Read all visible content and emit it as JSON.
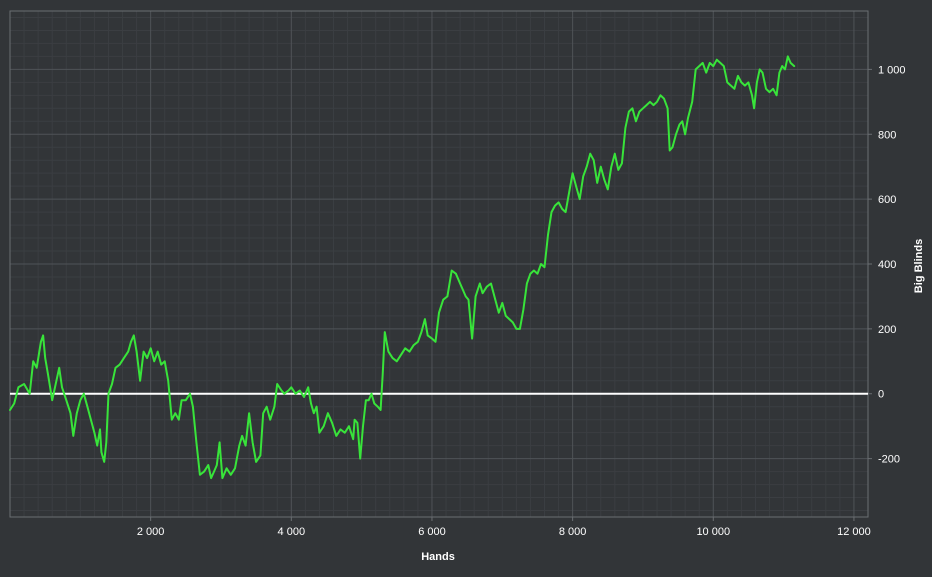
{
  "chart_data": {
    "type": "line",
    "title": "",
    "xlabel": "Hands",
    "ylabel": "Big Blinds",
    "xlim": [
      0,
      12200
    ],
    "ylim": [
      -380,
      1180
    ],
    "x_ticks": [
      2000,
      4000,
      6000,
      8000,
      10000,
      12000
    ],
    "x_tick_labels": [
      "2 000",
      "4 000",
      "6 000",
      "8 000",
      "10 000",
      "12 000"
    ],
    "y_ticks": [
      -200,
      0,
      200,
      400,
      600,
      800,
      1000
    ],
    "y_tick_labels": [
      "-200",
      "0",
      "200",
      "400",
      "600",
      "800",
      "1 000"
    ],
    "grid": true,
    "legend": "none",
    "colors": {
      "background": "#323538",
      "grid_major": "#4f5357",
      "grid_minor": "#3b3e42",
      "axis": "#6a6e72",
      "zero_line": "#ffffff",
      "series": "#38e43a",
      "text": "#ffffff"
    },
    "series": [
      {
        "name": "",
        "points": [
          [
            0,
            -50
          ],
          [
            60,
            -30
          ],
          [
            120,
            20
          ],
          [
            200,
            30
          ],
          [
            280,
            0
          ],
          [
            330,
            100
          ],
          [
            380,
            80
          ],
          [
            440,
            160
          ],
          [
            470,
            180
          ],
          [
            500,
            110
          ],
          [
            540,
            60
          ],
          [
            600,
            -20
          ],
          [
            650,
            30
          ],
          [
            700,
            80
          ],
          [
            740,
            20
          ],
          [
            800,
            -20
          ],
          [
            860,
            -60
          ],
          [
            900,
            -130
          ],
          [
            950,
            -60
          ],
          [
            1000,
            -20
          ],
          [
            1050,
            0
          ],
          [
            1100,
            -40
          ],
          [
            1150,
            -80
          ],
          [
            1200,
            -120
          ],
          [
            1240,
            -160
          ],
          [
            1280,
            -110
          ],
          [
            1300,
            -180
          ],
          [
            1340,
            -210
          ],
          [
            1370,
            -150
          ],
          [
            1400,
            0
          ],
          [
            1450,
            30
          ],
          [
            1500,
            80
          ],
          [
            1560,
            90
          ],
          [
            1620,
            110
          ],
          [
            1680,
            130
          ],
          [
            1720,
            160
          ],
          [
            1760,
            180
          ],
          [
            1800,
            130
          ],
          [
            1850,
            40
          ],
          [
            1900,
            130
          ],
          [
            1950,
            110
          ],
          [
            2000,
            140
          ],
          [
            2050,
            100
          ],
          [
            2100,
            130
          ],
          [
            2150,
            90
          ],
          [
            2200,
            100
          ],
          [
            2250,
            40
          ],
          [
            2300,
            -80
          ],
          [
            2350,
            -60
          ],
          [
            2400,
            -80
          ],
          [
            2440,
            -20
          ],
          [
            2500,
            -20
          ],
          [
            2560,
            0
          ],
          [
            2600,
            -40
          ],
          [
            2650,
            -150
          ],
          [
            2700,
            -250
          ],
          [
            2760,
            -240
          ],
          [
            2820,
            -220
          ],
          [
            2860,
            -260
          ],
          [
            2900,
            -240
          ],
          [
            2940,
            -220
          ],
          [
            2980,
            -150
          ],
          [
            3020,
            -260
          ],
          [
            3080,
            -230
          ],
          [
            3140,
            -250
          ],
          [
            3200,
            -230
          ],
          [
            3260,
            -160
          ],
          [
            3300,
            -130
          ],
          [
            3350,
            -160
          ],
          [
            3400,
            -60
          ],
          [
            3450,
            -150
          ],
          [
            3500,
            -210
          ],
          [
            3560,
            -190
          ],
          [
            3600,
            -60
          ],
          [
            3650,
            -40
          ],
          [
            3700,
            -80
          ],
          [
            3760,
            -40
          ],
          [
            3800,
            30
          ],
          [
            3860,
            10
          ],
          [
            3900,
            0
          ],
          [
            3960,
            10
          ],
          [
            4000,
            20
          ],
          [
            4060,
            0
          ],
          [
            4120,
            10
          ],
          [
            4180,
            -10
          ],
          [
            4240,
            20
          ],
          [
            4280,
            -30
          ],
          [
            4320,
            -60
          ],
          [
            4360,
            -40
          ],
          [
            4400,
            -120
          ],
          [
            4460,
            -100
          ],
          [
            4520,
            -60
          ],
          [
            4580,
            -90
          ],
          [
            4640,
            -130
          ],
          [
            4700,
            -110
          ],
          [
            4760,
            -120
          ],
          [
            4820,
            -100
          ],
          [
            4880,
            -140
          ],
          [
            4900,
            -80
          ],
          [
            4940,
            -90
          ],
          [
            4980,
            -200
          ],
          [
            5020,
            -100
          ],
          [
            5060,
            -20
          ],
          [
            5100,
            -20
          ],
          [
            5140,
            0
          ],
          [
            5180,
            -30
          ],
          [
            5230,
            -40
          ],
          [
            5270,
            -50
          ],
          [
            5300,
            60
          ],
          [
            5330,
            190
          ],
          [
            5380,
            130
          ],
          [
            5440,
            110
          ],
          [
            5500,
            100
          ],
          [
            5560,
            120
          ],
          [
            5620,
            140
          ],
          [
            5680,
            130
          ],
          [
            5740,
            150
          ],
          [
            5800,
            160
          ],
          [
            5850,
            190
          ],
          [
            5900,
            230
          ],
          [
            5940,
            180
          ],
          [
            6000,
            170
          ],
          [
            6050,
            160
          ],
          [
            6100,
            250
          ],
          [
            6160,
            290
          ],
          [
            6220,
            300
          ],
          [
            6280,
            380
          ],
          [
            6340,
            370
          ],
          [
            6400,
            340
          ],
          [
            6440,
            320
          ],
          [
            6480,
            300
          ],
          [
            6520,
            290
          ],
          [
            6570,
            170
          ],
          [
            6620,
            300
          ],
          [
            6680,
            340
          ],
          [
            6720,
            310
          ],
          [
            6780,
            330
          ],
          [
            6840,
            340
          ],
          [
            6900,
            290
          ],
          [
            6950,
            250
          ],
          [
            7000,
            280
          ],
          [
            7050,
            240
          ],
          [
            7100,
            230
          ],
          [
            7150,
            220
          ],
          [
            7200,
            200
          ],
          [
            7250,
            200
          ],
          [
            7300,
            260
          ],
          [
            7350,
            340
          ],
          [
            7400,
            370
          ],
          [
            7450,
            380
          ],
          [
            7500,
            370
          ],
          [
            7550,
            400
          ],
          [
            7600,
            390
          ],
          [
            7650,
            490
          ],
          [
            7700,
            560
          ],
          [
            7750,
            580
          ],
          [
            7800,
            590
          ],
          [
            7850,
            570
          ],
          [
            7900,
            560
          ],
          [
            7950,
            620
          ],
          [
            8000,
            680
          ],
          [
            8050,
            640
          ],
          [
            8100,
            600
          ],
          [
            8150,
            670
          ],
          [
            8200,
            700
          ],
          [
            8250,
            740
          ],
          [
            8300,
            720
          ],
          [
            8350,
            650
          ],
          [
            8400,
            700
          ],
          [
            8450,
            660
          ],
          [
            8500,
            630
          ],
          [
            8550,
            700
          ],
          [
            8600,
            740
          ],
          [
            8650,
            690
          ],
          [
            8700,
            710
          ],
          [
            8750,
            820
          ],
          [
            8800,
            870
          ],
          [
            8850,
            880
          ],
          [
            8900,
            840
          ],
          [
            8950,
            870
          ],
          [
            9000,
            880
          ],
          [
            9050,
            890
          ],
          [
            9100,
            900
          ],
          [
            9150,
            890
          ],
          [
            9200,
            900
          ],
          [
            9250,
            920
          ],
          [
            9300,
            910
          ],
          [
            9350,
            880
          ],
          [
            9380,
            750
          ],
          [
            9420,
            760
          ],
          [
            9470,
            800
          ],
          [
            9520,
            830
          ],
          [
            9560,
            840
          ],
          [
            9600,
            800
          ],
          [
            9640,
            850
          ],
          [
            9700,
            900
          ],
          [
            9750,
            1000
          ],
          [
            9800,
            1010
          ],
          [
            9850,
            1020
          ],
          [
            9900,
            990
          ],
          [
            9950,
            1020
          ],
          [
            10000,
            1010
          ],
          [
            10050,
            1030
          ],
          [
            10100,
            1020
          ],
          [
            10150,
            1010
          ],
          [
            10200,
            960
          ],
          [
            10250,
            950
          ],
          [
            10300,
            940
          ],
          [
            10350,
            980
          ],
          [
            10400,
            960
          ],
          [
            10450,
            950
          ],
          [
            10500,
            960
          ],
          [
            10550,
            920
          ],
          [
            10580,
            880
          ],
          [
            10620,
            960
          ],
          [
            10660,
            1000
          ],
          [
            10700,
            990
          ],
          [
            10750,
            940
          ],
          [
            10800,
            930
          ],
          [
            10850,
            940
          ],
          [
            10900,
            920
          ],
          [
            10940,
            990
          ],
          [
            10980,
            1010
          ],
          [
            11020,
            1000
          ],
          [
            11060,
            1040
          ],
          [
            11100,
            1020
          ],
          [
            11150,
            1010
          ]
        ]
      }
    ]
  }
}
